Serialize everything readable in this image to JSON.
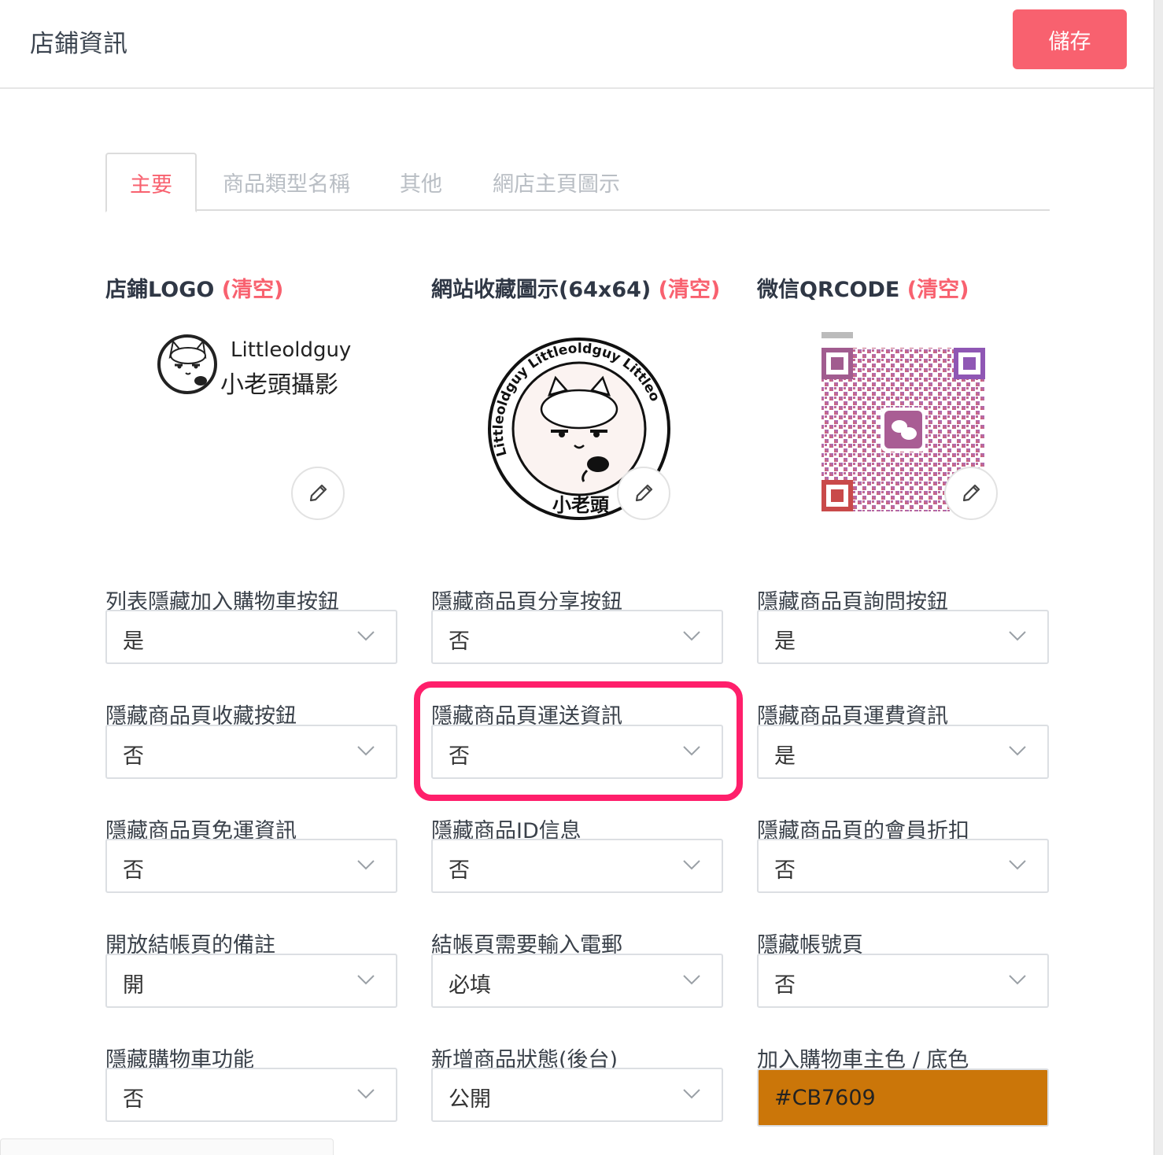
{
  "header": {
    "title": "店鋪資訊",
    "save_label": "儲存"
  },
  "tabs": [
    {
      "label": "主要",
      "active": true
    },
    {
      "label": "商品類型名稱",
      "active": false
    },
    {
      "label": "其他",
      "active": false
    },
    {
      "label": "網店主頁圖示",
      "active": false
    }
  ],
  "images": {
    "logo": {
      "label": "店鋪LOGO",
      "clear": "(清空)",
      "brand_en": "Littleoldguy",
      "brand_zh": "小老頭攝影"
    },
    "favicon": {
      "label": "網站收藏圖示(64x64)",
      "clear": "(清空)",
      "ring_text": "Littleoldguy Littleoldguy Littleo",
      "seal_text": "小老頭"
    },
    "qrcode": {
      "label": "微信QRCODE",
      "clear": "(清空)"
    }
  },
  "fields": [
    {
      "label": "列表隱藏加入購物車按鈕",
      "value": "是"
    },
    {
      "label": "隱藏商品頁分享按鈕",
      "value": "否"
    },
    {
      "label": "隱藏商品頁詢問按鈕",
      "value": "是"
    },
    {
      "label": "隱藏商品頁收藏按鈕",
      "value": "否"
    },
    {
      "label": "隱藏商品頁運送資訊",
      "value": "否"
    },
    {
      "label": "隱藏商品頁運費資訊",
      "value": "是"
    },
    {
      "label": "隱藏商品頁免運資訊",
      "value": "否"
    },
    {
      "label": "隱藏商品ID信息",
      "value": "否"
    },
    {
      "label": "隱藏商品頁的會員折扣",
      "value": "否"
    },
    {
      "label": "開放結帳頁的備註",
      "value": "開"
    },
    {
      "label": "結帳頁需要輸入電郵",
      "value": "必填"
    },
    {
      "label": "隱藏帳號頁",
      "value": "否"
    },
    {
      "label": "隱藏購物車功能",
      "value": "否"
    },
    {
      "label": "新增商品狀態(後台)",
      "value": "公開"
    }
  ],
  "cart_color": {
    "label": "加入購物車主色 / 底色",
    "value": "#CB7609",
    "swatch": "#CB7609"
  },
  "colors": {
    "accent": "#f8616f",
    "highlight": "#ff1f6b"
  }
}
